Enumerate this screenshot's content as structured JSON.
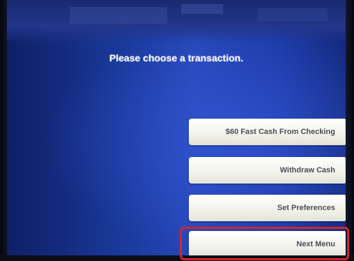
{
  "screen": {
    "title": "Please choose a transaction."
  },
  "menu": [
    {
      "label": "$60 Fast Cash From Checking"
    },
    {
      "label": "Withdraw Cash"
    },
    {
      "label": "Set Preferences"
    },
    {
      "label": "Next Menu"
    }
  ],
  "highlight": {
    "color": "#d4252b"
  }
}
